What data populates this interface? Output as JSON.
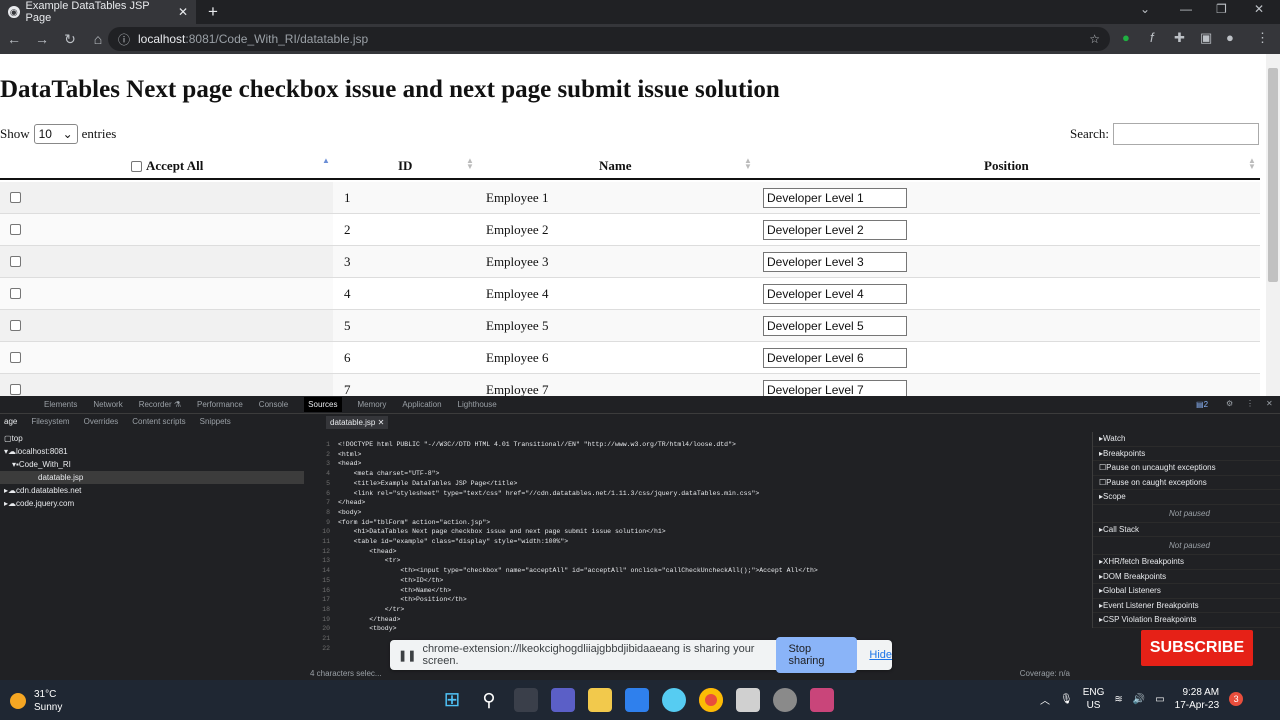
{
  "browser": {
    "tab_title": "Example DataTables JSP Page",
    "tab_close": "✕",
    "new_tab": "+",
    "url_host": "localhost",
    "url_path": ":8081/Code_With_RI/datatable.jsp"
  },
  "page": {
    "heading": "DataTables Next page checkbox issue and next page submit issue solution",
    "show_label": "Show",
    "length_value": "10",
    "entries_label": "entries",
    "search_label": "Search:",
    "columns": {
      "accept_all": "Accept All",
      "id": "ID",
      "name": "Name",
      "position": "Position"
    },
    "rows": [
      {
        "id": "1",
        "name": "Employee 1",
        "position": "Developer Level 1"
      },
      {
        "id": "2",
        "name": "Employee 2",
        "position": "Developer Level 2"
      },
      {
        "id": "3",
        "name": "Employee 3",
        "position": "Developer Level 3"
      },
      {
        "id": "4",
        "name": "Employee 4",
        "position": "Developer Level 4"
      },
      {
        "id": "5",
        "name": "Employee 5",
        "position": "Developer Level 5"
      },
      {
        "id": "6",
        "name": "Employee 6",
        "position": "Developer Level 6"
      },
      {
        "id": "7",
        "name": "Employee 7",
        "position": "Developer Level 7"
      }
    ]
  },
  "devtools": {
    "tabs": [
      "Elements",
      "Network",
      "Recorder ⚗",
      "Performance",
      "Console",
      "Sources",
      "Memory",
      "Application",
      "Lighthouse"
    ],
    "active_tab": "Sources",
    "nav_tabs": [
      "age",
      "Filesystem",
      "Overrides",
      "Content scripts",
      "Snippets"
    ],
    "tree": [
      "top",
      "localhost:8081",
      "Code_With_RI",
      "datatable.jsp",
      "cdn.datatables.net",
      "code.jquery.com"
    ],
    "editor_tab": "datatable.jsp ✕",
    "right_pane": [
      "Watch",
      "Breakpoints",
      "Pause on uncaught exceptions",
      "Pause on caught exceptions",
      "Scope",
      "Not paused",
      "Call Stack",
      "Not paused",
      "XHR/fetch Breakpoints",
      "DOM Breakpoints",
      "Global Listeners",
      "Event Listener Breakpoints",
      "CSP Violation Breakpoints"
    ],
    "status_left": "4 characters selec...",
    "status_right": "Coverage: n/a",
    "issues_count": "2"
  },
  "code_lines": [
    "<!DOCTYPE html PUBLIC \"-//W3C//DTD HTML 4.01 Transitional//EN\" \"http://www.w3.org/TR/html4/loose.dtd\">",
    "<html>",
    "<head>",
    "    <meta charset=\"UTF-8\">",
    "    <title>Example DataTables JSP Page</title>",
    "    <link rel=\"stylesheet\" type=\"text/css\" href=\"//cdn.datatables.net/1.11.3/css/jquery.dataTables.min.css\">",
    "</head>",
    "<body>",
    "<form id=\"tblForm\" action=\"action.jsp\">",
    "    <h1>DataTables Next page checkbox issue and next page submit issue solution</h1>",
    "    <table id=\"example\" class=\"display\" style=\"width:100%\">",
    "        <thead>",
    "            <tr>",
    "                <th><input type=\"checkbox\" name=\"acceptAll\" id=\"acceptAll\" onclick=\"callCheckUncheckAll();\">Accept All</th>",
    "                <th>ID</th>",
    "                <th>Name</th>",
    "                <th>Position</th>",
    "            </tr>",
    "        </thead>",
    "        <tbody>",
    "",
    ""
  ],
  "share": {
    "text": "chrome-extension://lkeokcighogdliiajgbbdjibidaaeang is sharing your screen.",
    "stop": "Stop sharing",
    "hide": "Hide"
  },
  "overlay": {
    "subscribe": "SUBSCRIBE"
  },
  "taskbar": {
    "temp": "31°C",
    "weather": "Sunny",
    "lang1": "ENG",
    "lang2": "US",
    "time": "9:28 AM",
    "date": "17-Apr-23",
    "notifications": "3"
  }
}
